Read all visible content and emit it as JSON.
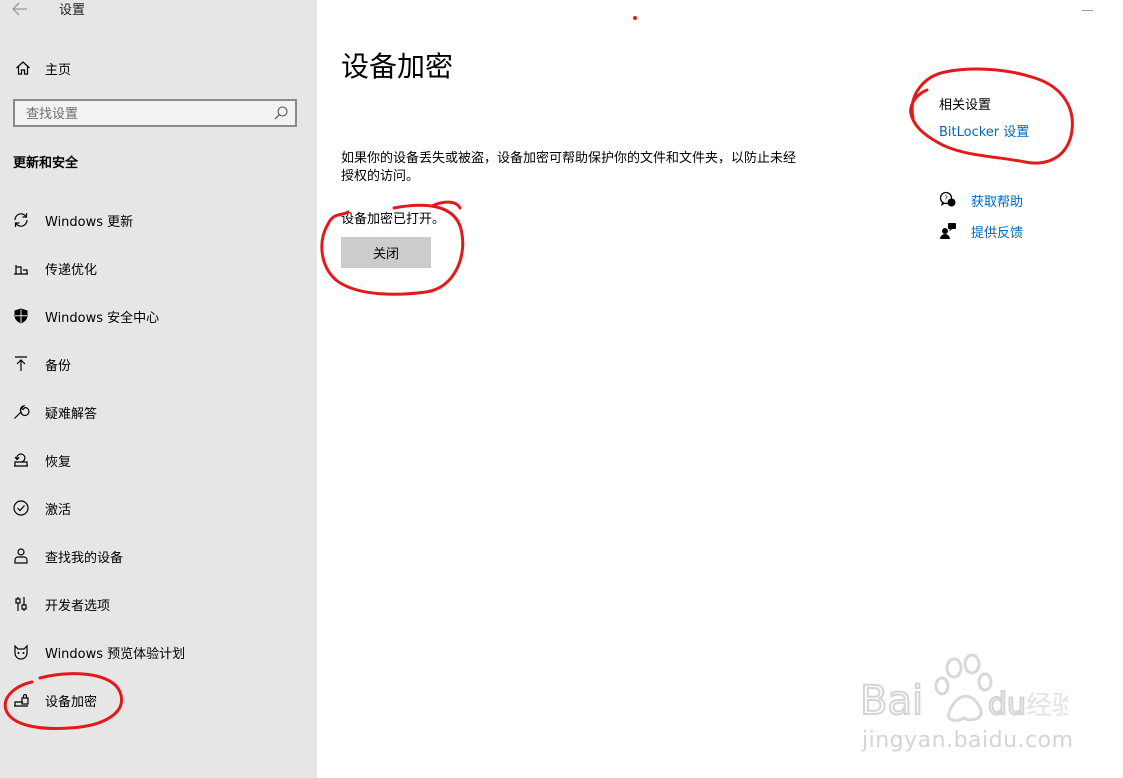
{
  "window": {
    "back_icon": "back-arrow-icon",
    "title": "设置"
  },
  "sidebar": {
    "home_label": "主页",
    "search_placeholder": "查找设置",
    "section_title": "更新和安全",
    "items": [
      {
        "label": "Windows 更新",
        "icon": "sync-icon"
      },
      {
        "label": "传递优化",
        "icon": "delivery-optimization-icon"
      },
      {
        "label": "Windows 安全中心",
        "icon": "shield-icon"
      },
      {
        "label": "备份",
        "icon": "backup-arrow-icon"
      },
      {
        "label": "疑难解答",
        "icon": "wrench-icon"
      },
      {
        "label": "恢复",
        "icon": "recovery-icon"
      },
      {
        "label": "激活",
        "icon": "activation-check-icon"
      },
      {
        "label": "查找我的设备",
        "icon": "find-device-person-icon"
      },
      {
        "label": "开发者选项",
        "icon": "developer-sliders-icon"
      },
      {
        "label": "Windows 预览体验计划",
        "icon": "insider-cat-icon"
      },
      {
        "label": "设备加密",
        "icon": "device-encryption-icon"
      }
    ]
  },
  "main": {
    "page_title": "设备加密",
    "description": "如果你的设备丢失或被盗，设备加密可帮助保护你的文件和文件夹，以防止未经授权的访问。",
    "status_text": "设备加密已打开。",
    "turn_off_button": "关闭"
  },
  "related": {
    "title": "相关设置",
    "bitlocker_link": "BitLocker 设置",
    "help_links": [
      {
        "label": "获取帮助",
        "icon": "help-chat-icon"
      },
      {
        "label": "提供反馈",
        "icon": "feedback-person-icon"
      }
    ]
  },
  "watermark": {
    "url": "jingyan.baidu.com"
  },
  "colors": {
    "sidebar_bg": "#e6e6e6",
    "link": "#0067b8",
    "button_bg": "#cccccc",
    "annotation_red": "#e21a1a"
  }
}
